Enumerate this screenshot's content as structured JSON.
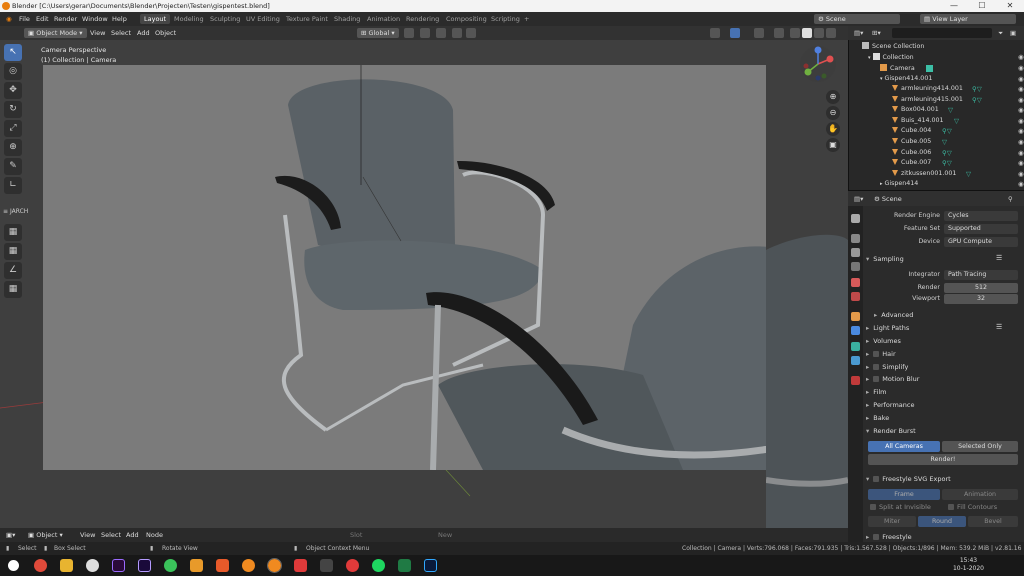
{
  "window": {
    "title": "Blender [C:\\Users\\gerar\\Documents\\Blender\\Projecten\\Testen\\gispentest.blend]",
    "min": "—",
    "max": "☐",
    "close": "✕"
  },
  "menu": [
    "File",
    "Edit",
    "Render",
    "Window",
    "Help"
  ],
  "workspaces": [
    "Layout",
    "Modeling",
    "Sculpting",
    "UV Editing",
    "Texture Paint",
    "Shading",
    "Animation",
    "Rendering",
    "Compositing",
    "Scripting"
  ],
  "workspace_add": "+",
  "scene": "Scene",
  "view_layer": "View Layer",
  "viewport": {
    "mode": "Object Mode",
    "menus": [
      "View",
      "Select",
      "Add",
      "Object"
    ],
    "orientation": "Global",
    "camera_title": "Camera Perspective",
    "camera_sub": "(1) Collection | Camera"
  },
  "tools": [
    "↖",
    "◎",
    "✥",
    "↻",
    "⤢",
    "⊕",
    "✎",
    "∟"
  ],
  "tools_lower": [
    "▦",
    "▦",
    "∠",
    "▦"
  ],
  "jarch_label": "JARCH",
  "nav_buttons": [
    "⊕",
    "⊖",
    "✋",
    "▣"
  ],
  "outliner": {
    "search_placeholder": "",
    "rows": [
      {
        "label": "Scene Collection",
        "indent": 0
      },
      {
        "label": "Collection",
        "indent": 1
      },
      {
        "label": "Camera",
        "indent": 2
      },
      {
        "label": "Gispen414.001",
        "indent": 2
      },
      {
        "label": "armleuning414.001",
        "indent": 3,
        "mods": "⚲▽"
      },
      {
        "label": "armleuning415.001",
        "indent": 3,
        "mods": "⚲▽"
      },
      {
        "label": "Box004.001",
        "indent": 3,
        "mods": "▽"
      },
      {
        "label": "Buis_414.001",
        "indent": 3,
        "mods": "▽"
      },
      {
        "label": "Cube.004",
        "indent": 3,
        "mods": "⚲▽"
      },
      {
        "label": "Cube.005",
        "indent": 3,
        "mods": "▽"
      },
      {
        "label": "Cube.006",
        "indent": 3,
        "mods": "⚲▽"
      },
      {
        "label": "Cube.007",
        "indent": 3,
        "mods": "⚲▽"
      },
      {
        "label": "zitkussen001.001",
        "indent": 3,
        "mods": "▽"
      },
      {
        "label": "Gispen414",
        "indent": 2
      }
    ]
  },
  "properties": {
    "context": "Scene",
    "render_engine_label": "Render Engine",
    "render_engine": "Cycles",
    "feature_set_label": "Feature Set",
    "feature_set": "Supported",
    "device_label": "Device",
    "device": "GPU Compute",
    "sampling": "Sampling",
    "integrator_label": "Integrator",
    "integrator": "Path Tracing",
    "render_label": "Render",
    "render_samples": "512",
    "viewport_label": "Viewport",
    "viewport_samples": "32",
    "advanced": "Advanced",
    "light_paths": "Light Paths",
    "volumes": "Volumes",
    "hair": "Hair",
    "simplify": "Simplify",
    "motion_blur": "Motion Blur",
    "film": "Film",
    "performance": "Performance",
    "bake": "Bake",
    "render_burst": "Render Burst",
    "all_cameras": "All Cameras",
    "selected_only": "Selected Only",
    "render_btn": "Render!",
    "freestyle_svg": "Freestyle SVG Export",
    "frame": "Frame",
    "animation": "Animation",
    "split_invisible": "Split at Invisible",
    "fill_contours": "Fill Contours",
    "miter": "Miter",
    "round": "Round",
    "bevel": "Bevel",
    "freestyle": "Freestyle"
  },
  "timeline": {
    "menus": [
      "Object",
      "View",
      "Select",
      "Add",
      "Node"
    ],
    "slot": "Slot",
    "new": "New"
  },
  "status": {
    "select": "Select",
    "box_select": "Box Select",
    "rotate_view": "Rotate View",
    "context_menu": "Object Context Menu",
    "stats": "Collection | Camera | Verts:796.068 | Faces:791.935 | Tris:1.567.528 | Objects:1/896 | Mem: 539.2 MiB | v2.81.16"
  },
  "clock": {
    "time": "15:43",
    "date": "10-1-2020"
  },
  "colors": {
    "accent": "#4772b3",
    "viewport_bg": "#3f3f3f",
    "camera_bg": "#7b7b7b",
    "chair": "#5a6166"
  }
}
